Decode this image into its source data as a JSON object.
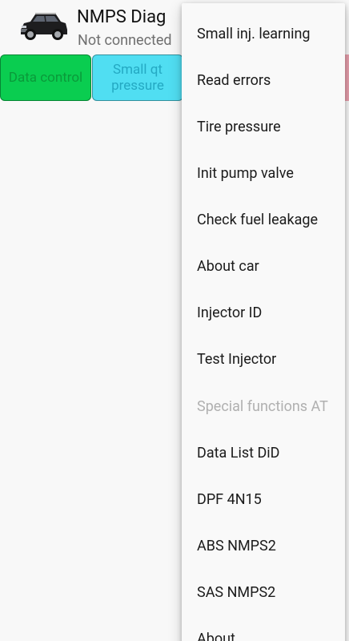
{
  "app": {
    "title": "NMPS Diag",
    "status": "Not connected",
    "car_icon": "car-icon"
  },
  "tabs": [
    {
      "label": "Data control",
      "color": "#0acd50"
    },
    {
      "label": "Small qt\npressure",
      "color": "#50def2"
    },
    {
      "label": "",
      "color": "#e8a0ad"
    }
  ],
  "menu": {
    "items": [
      {
        "label": "Small inj. learning",
        "enabled": true
      },
      {
        "label": "Read errors",
        "enabled": true
      },
      {
        "label": "Tire pressure",
        "enabled": true
      },
      {
        "label": "Init pump valve",
        "enabled": true
      },
      {
        "label": "Check fuel leakage",
        "enabled": true
      },
      {
        "label": "About car",
        "enabled": true
      },
      {
        "label": "Injector ID",
        "enabled": true
      },
      {
        "label": "Test Injector",
        "enabled": true
      },
      {
        "label": "Special functions AT",
        "enabled": false
      },
      {
        "label": "Data List DiD",
        "enabled": true
      },
      {
        "label": "DPF 4N15",
        "enabled": true
      },
      {
        "label": "ABS NMPS2",
        "enabled": true
      },
      {
        "label": "SAS NMPS2",
        "enabled": true
      },
      {
        "label": "About",
        "enabled": true
      }
    ]
  }
}
